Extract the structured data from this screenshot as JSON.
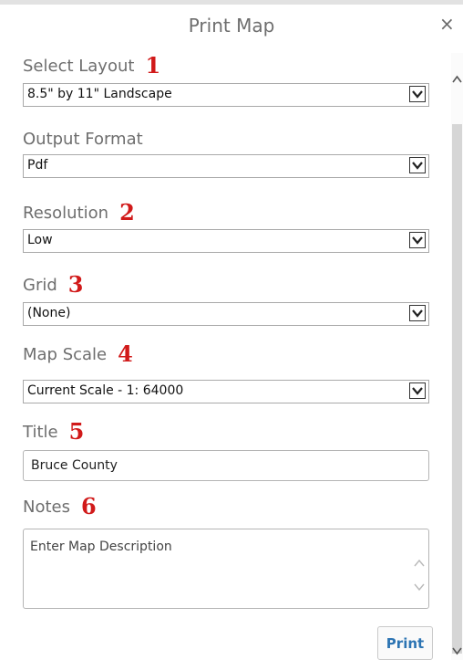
{
  "dialog": {
    "title": "Print Map",
    "close": "×"
  },
  "fields": {
    "layout": {
      "label": "Select Layout",
      "marker": "1",
      "value": "8.5\" by 11\" Landscape"
    },
    "format": {
      "label": "Output Format",
      "value": "Pdf"
    },
    "resolution": {
      "label": "Resolution",
      "marker": "2",
      "value": "Low"
    },
    "grid": {
      "label": "Grid",
      "marker": "3",
      "value": "(None)"
    },
    "scale": {
      "label": "Map Scale",
      "marker": "4",
      "value": "Current Scale - 1: 64000"
    },
    "title": {
      "label": "Title",
      "marker": "5",
      "value": "Bruce County"
    },
    "notes": {
      "label": "Notes",
      "marker": "6",
      "placeholder": "Enter Map Description"
    }
  },
  "buttons": {
    "print": "Print"
  },
  "icons": {
    "close": "close-icon",
    "dropdown": "chevron-down-icon",
    "scroll_up": "chevron-up-icon",
    "scroll_down": "chevron-down-icon"
  },
  "colors": {
    "marker": "#d11a1a",
    "print_text": "#2c74b3",
    "label": "#6e6e6e"
  }
}
